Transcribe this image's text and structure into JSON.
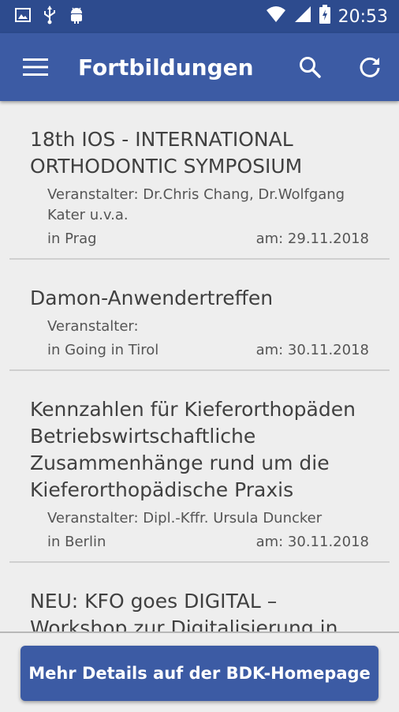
{
  "status_bar": {
    "time": "20:53",
    "icons": [
      "image-icon",
      "usb-icon",
      "android-icon",
      "wifi-icon",
      "signal-icon",
      "battery-icon"
    ]
  },
  "app_bar": {
    "title": "Fortbildungen",
    "icons": [
      "menu-icon",
      "search-icon",
      "refresh-icon"
    ]
  },
  "events": [
    {
      "title": "18th IOS - INTERNATIONAL ORTHODONTIC SYMPOSIUM",
      "organizer": "Veranstalter: Dr.Chris Chang, Dr.Wolfgang Kater u.v.a.",
      "location": "in Prag",
      "date": "am: 29.11.2018"
    },
    {
      "title": "Damon-Anwendertreffen",
      "organizer": "Veranstalter:",
      "location": "in Going in Tirol",
      "date": "am: 30.11.2018"
    },
    {
      "title": "Kennzahlen für Kieferorthopäden Betriebswirtschaftliche Zusammenhänge rund um die Kieferorthopädische Praxis",
      "organizer": "Veranstalter: Dipl.-Kffr. Ursula Duncker",
      "location": "in Berlin",
      "date": "am: 30.11.2018"
    },
    {
      "title": "NEU: KFO goes DIGITAL – Workshop zur Digitalisierung in der Kieferorthopädie",
      "organizer": "",
      "location": "",
      "date": ""
    }
  ],
  "footer": {
    "button_label": "Mehr Details auf der BDK-Homepage"
  },
  "colors": {
    "status_bar": "#2d4b8e",
    "app_bar": "#3c5ba4",
    "background": "#eeeeee",
    "button": "#3c5ba4"
  }
}
